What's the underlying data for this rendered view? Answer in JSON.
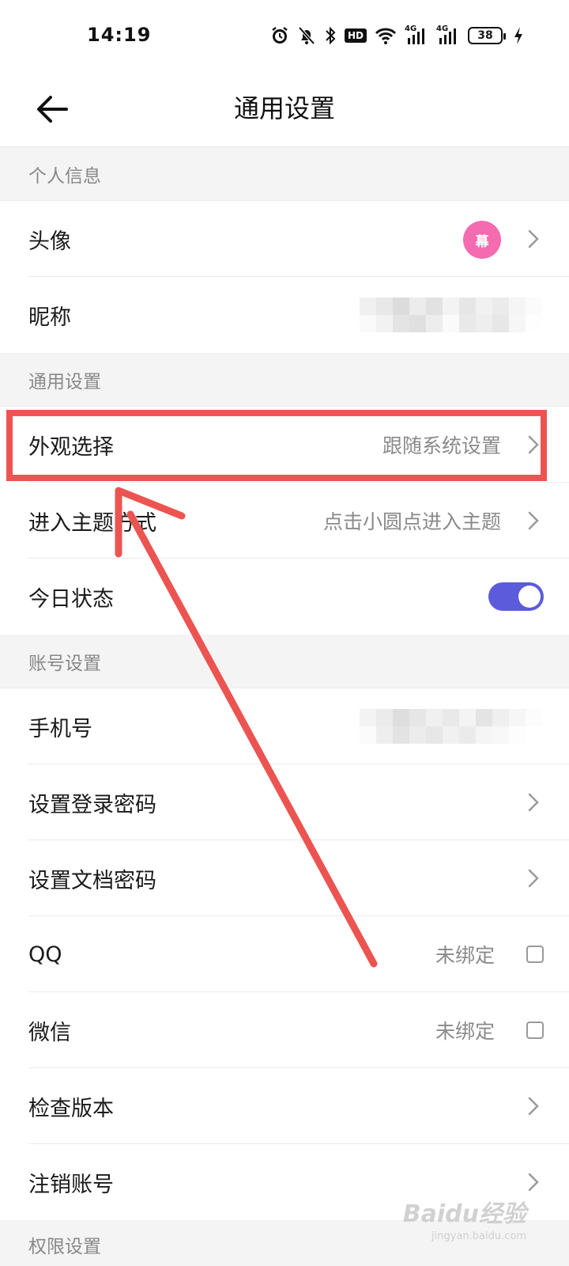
{
  "status_bar": {
    "time": "14:19",
    "icons": [
      "alarm-icon",
      "mute-icon",
      "bluetooth-icon",
      "hd-icon",
      "wifi-icon",
      "signal-4g-icon",
      "signal-4g-icon",
      "battery-icon",
      "charging-icon"
    ],
    "hd_label": "HD",
    "net_label_1": "4G",
    "net_label_2": "4G",
    "battery_level": "38"
  },
  "header": {
    "title": "通用设置",
    "back_icon": "back-arrow-icon"
  },
  "sections": {
    "personal": {
      "title": "个人信息",
      "avatar_label": "头像",
      "avatar_text": "幕",
      "avatar_color": "#f56bb0",
      "nickname_label": "昵称"
    },
    "general": {
      "title": "通用设置",
      "appearance_label": "外观选择",
      "appearance_value": "跟随系统设置",
      "theme_entry_label": "进入主题方式",
      "theme_entry_value": "点击小圆点进入主题",
      "today_status_label": "今日状态",
      "today_status_on": true
    },
    "account": {
      "title": "账号设置",
      "phone_label": "手机号",
      "login_password_label": "设置登录密码",
      "doc_password_label": "设置文档密码",
      "qq_label": "QQ",
      "qq_value": "未绑定",
      "wechat_label": "微信",
      "wechat_value": "未绑定",
      "check_version_label": "检查版本",
      "delete_account_label": "注销账号"
    },
    "permissions": {
      "title": "权限设置"
    }
  },
  "colors": {
    "accent_toggle": "#5b5bdc",
    "highlight_annotation": "#ec5451",
    "section_bg": "#f4f4f5"
  },
  "watermark": {
    "text": "Baidu经验",
    "sub": "jingyan.baidu.com"
  }
}
